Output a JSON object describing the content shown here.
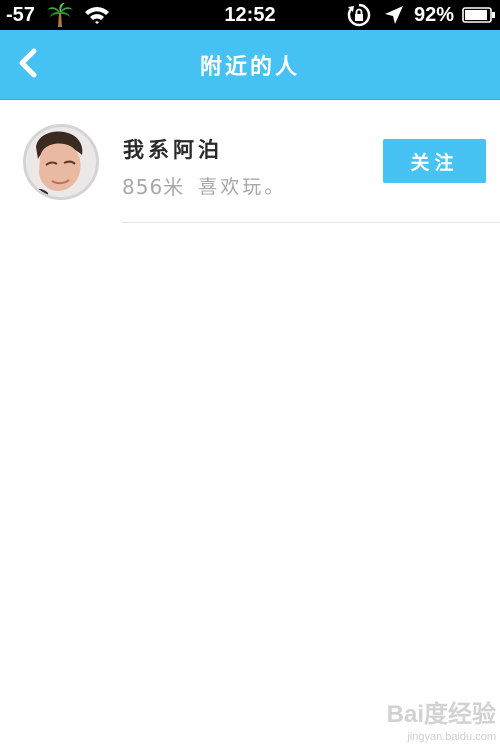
{
  "status_bar": {
    "signal": "-57",
    "carrier_icon": "palm-tree-icon",
    "time": "12:52",
    "battery_percent": "92%"
  },
  "nav": {
    "title": "附近的人",
    "back_icon": "chevron-left-icon"
  },
  "people": [
    {
      "name": "我系阿泊",
      "distance": "856米",
      "bio": "喜欢玩。",
      "follow_label": "关注"
    }
  ],
  "watermark": {
    "logo": "Bai度经验",
    "url": "jingyan.baidu.com"
  },
  "colors": {
    "accent": "#45c2f3",
    "text_primary": "#2a2a2a",
    "text_secondary": "#a8a8a8"
  }
}
